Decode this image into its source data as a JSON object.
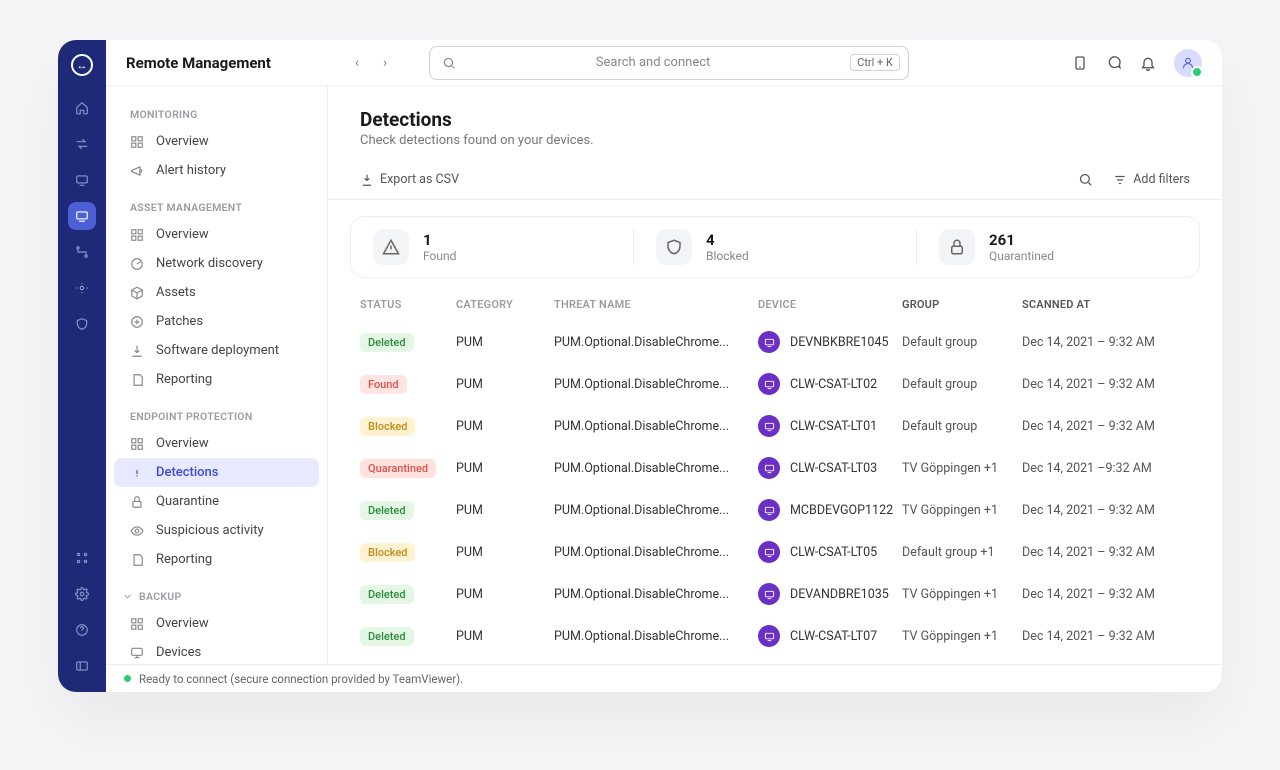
{
  "app": {
    "title": "Remote Management"
  },
  "search": {
    "placeholder": "Search and connect",
    "kbd": "Ctrl + K"
  },
  "sidebar": {
    "monitoring": {
      "header": "MONITORING",
      "items": [
        {
          "label": "Overview"
        },
        {
          "label": "Alert history"
        }
      ]
    },
    "asset": {
      "header": "ASSET MANAGEMENT",
      "items": [
        {
          "label": "Overview"
        },
        {
          "label": "Network discovery"
        },
        {
          "label": "Assets"
        },
        {
          "label": "Patches"
        },
        {
          "label": "Software deployment"
        },
        {
          "label": "Reporting"
        }
      ]
    },
    "endpoint": {
      "header": "ENDPOINT PROTECTION",
      "items": [
        {
          "label": "Overview"
        },
        {
          "label": "Detections"
        },
        {
          "label": "Quarantine"
        },
        {
          "label": "Suspicious activity"
        },
        {
          "label": "Reporting"
        }
      ]
    },
    "backup": {
      "header": "BACKUP",
      "items": [
        {
          "label": "Overview"
        },
        {
          "label": "Devices"
        }
      ]
    }
  },
  "page": {
    "title": "Detections",
    "subtitle": "Check detections found on your devices.",
    "export": "Export as CSV",
    "add_filters": "Add filters"
  },
  "stats": [
    {
      "value": "1",
      "label": "Found"
    },
    {
      "value": "4",
      "label": "Blocked"
    },
    {
      "value": "261",
      "label": "Quarantined"
    }
  ],
  "table": {
    "headers": {
      "status": "STATUS",
      "category": "CATEGORY",
      "threat": "THREAT NAME",
      "device": "DEVICE",
      "group": "GROUP",
      "scanned": "SCANNED AT"
    },
    "rows": [
      {
        "status": "Deleted",
        "status_class": "b-deleted",
        "category": "PUM",
        "threat": "PUM.Optional.DisableChrome...",
        "device": "DEVNBKBRE1045",
        "group": "Default group",
        "scanned": "Dec 14, 2021 – 9:32 AM"
      },
      {
        "status": "Found",
        "status_class": "b-found",
        "category": "PUM",
        "threat": "PUM.Optional.DisableChrome...",
        "device": "CLW-CSAT-LT02",
        "group": "Default group",
        "scanned": "Dec 14, 2021 – 9:32 AM"
      },
      {
        "status": "Blocked",
        "status_class": "b-blocked",
        "category": "PUM",
        "threat": "PUM.Optional.DisableChrome...",
        "device": "CLW-CSAT-LT01",
        "group": "Default group",
        "scanned": "Dec 14, 2021 – 9:32 AM"
      },
      {
        "status": "Quarantined",
        "status_class": "b-quarantined",
        "category": "PUM",
        "threat": "PUM.Optional.DisableChrome...",
        "device": "CLW-CSAT-LT03",
        "group": "TV Göppingen +1",
        "scanned": "Dec 14, 2021 –9:32 AM"
      },
      {
        "status": "Deleted",
        "status_class": "b-deleted",
        "category": "PUM",
        "threat": "PUM.Optional.DisableChrome...",
        "device": "MCBDEVGOP1122",
        "group": "TV Göppingen +1",
        "scanned": "Dec 14, 2021 – 9:32 AM"
      },
      {
        "status": "Blocked",
        "status_class": "b-blocked",
        "category": "PUM",
        "threat": "PUM.Optional.DisableChrome...",
        "device": "CLW-CSAT-LT05",
        "group": "Default group +1",
        "scanned": "Dec 14, 2021 – 9:32 AM"
      },
      {
        "status": "Deleted",
        "status_class": "b-deleted",
        "category": "PUM",
        "threat": "PUM.Optional.DisableChrome...",
        "device": "DEVANDBRE1035",
        "group": "TV Göppingen +1",
        "scanned": "Dec 14, 2021 – 9:32 AM"
      },
      {
        "status": "Deleted",
        "status_class": "b-deleted",
        "category": "PUM",
        "threat": "PUM.Optional.DisableChrome...",
        "device": "CLW-CSAT-LT07",
        "group": "TV Göppingen +1",
        "scanned": "Dec 14, 2021 – 9:32 AM"
      }
    ]
  },
  "footer": {
    "text": "Ready to connect (secure connection provided by TeamViewer)."
  }
}
